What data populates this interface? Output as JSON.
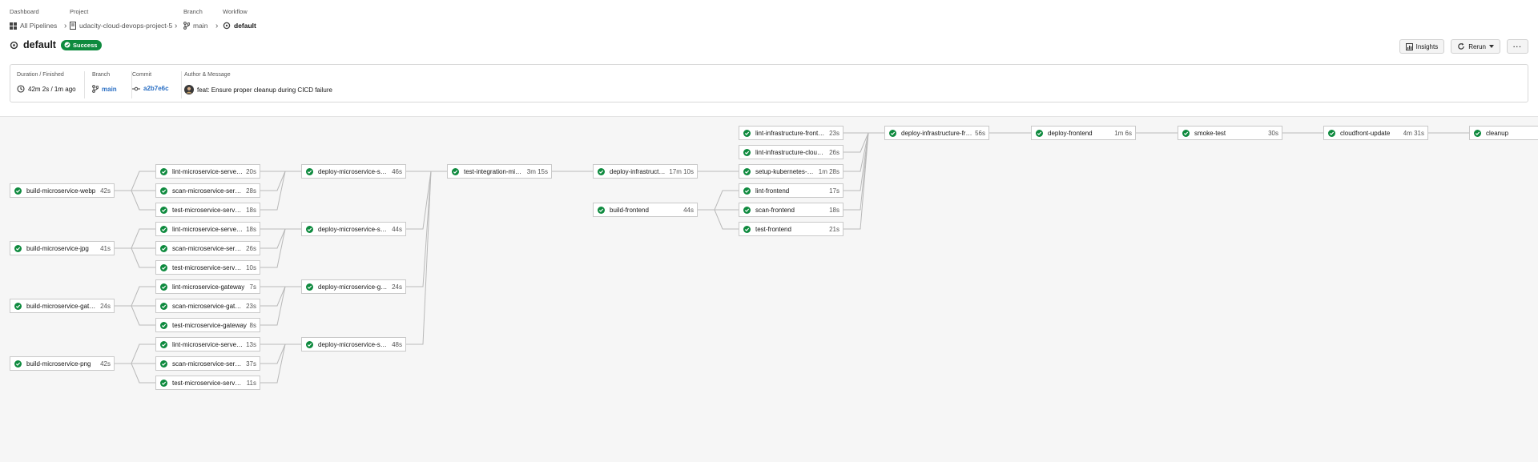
{
  "breadcrumbs": [
    {
      "caption": "Dashboard",
      "value": "All Pipelines",
      "icon": "pipelines-grid-icon"
    },
    {
      "caption": "Project",
      "value": "udacity-cloud-devops-project-5",
      "icon": "project-file-icon"
    },
    {
      "caption": "Branch",
      "value": "main",
      "icon": "branch-icon"
    },
    {
      "caption": "Workflow",
      "value": "default",
      "icon": "workflow-icon"
    }
  ],
  "workflow": {
    "title": "default",
    "status": "Success"
  },
  "actions": {
    "insights": "Insights",
    "rerun": "Rerun",
    "more": "···"
  },
  "info": {
    "duration_label": "Duration / Finished",
    "duration_value": "42m 2s / 1m ago",
    "branch_label": "Branch",
    "branch_value": "main",
    "commit_label": "Commit",
    "commit_value": "a2b7e6c",
    "author_label": "Author & Message",
    "message": "feat: Ensure proper cleanup during CICD failure"
  },
  "jobs": [
    {
      "id": "b_webp",
      "name": "build-microservice-webp",
      "duration": "42s",
      "needs": []
    },
    {
      "id": "b_jpg",
      "name": "build-microservice-jpg",
      "duration": "41s",
      "needs": []
    },
    {
      "id": "b_gw",
      "name": "build-microservice-gatew…",
      "duration": "24s",
      "needs": []
    },
    {
      "id": "b_png",
      "name": "build-microservice-png",
      "duration": "42s",
      "needs": []
    },
    {
      "id": "l_webp",
      "name": "lint-microservice-server-w…",
      "duration": "20s",
      "needs": [
        "b_webp"
      ]
    },
    {
      "id": "s_webp",
      "name": "scan-microservice-server-…",
      "duration": "28s",
      "needs": [
        "b_webp"
      ]
    },
    {
      "id": "t_webp",
      "name": "test-microservice-server-…",
      "duration": "18s",
      "needs": [
        "b_webp"
      ]
    },
    {
      "id": "l_jpg",
      "name": "lint-microservice-server-jpg",
      "duration": "18s",
      "needs": [
        "b_jpg"
      ]
    },
    {
      "id": "s_jpg",
      "name": "scan-microservice-server-…",
      "duration": "26s",
      "needs": [
        "b_jpg"
      ]
    },
    {
      "id": "t_jpg",
      "name": "test-microservice-server-j…",
      "duration": "10s",
      "needs": [
        "b_jpg"
      ]
    },
    {
      "id": "l_gw",
      "name": "lint-microservice-gateway",
      "duration": "7s",
      "needs": [
        "b_gw"
      ]
    },
    {
      "id": "s_gw",
      "name": "scan-microservice-gatew…",
      "duration": "23s",
      "needs": [
        "b_gw"
      ]
    },
    {
      "id": "t_gw",
      "name": "test-microservice-gateway",
      "duration": "8s",
      "needs": [
        "b_gw"
      ]
    },
    {
      "id": "l_png",
      "name": "lint-microservice-server-p…",
      "duration": "13s",
      "needs": [
        "b_png"
      ]
    },
    {
      "id": "s_png",
      "name": "scan-microservice-server-…",
      "duration": "37s",
      "needs": [
        "b_png"
      ]
    },
    {
      "id": "t_png",
      "name": "test-microservice-server-…",
      "duration": "11s",
      "needs": [
        "b_png"
      ]
    },
    {
      "id": "d_webp",
      "name": "deploy-microservice-serv…",
      "duration": "46s",
      "needs": [
        "l_webp",
        "s_webp",
        "t_webp"
      ]
    },
    {
      "id": "d_jpg",
      "name": "deploy-microservice-serv…",
      "duration": "44s",
      "needs": [
        "l_jpg",
        "s_jpg",
        "t_jpg"
      ]
    },
    {
      "id": "d_gw",
      "name": "deploy-microservice-gate…",
      "duration": "24s",
      "needs": [
        "l_gw",
        "s_gw",
        "t_gw"
      ]
    },
    {
      "id": "d_png",
      "name": "deploy-microservice-serv…",
      "duration": "48s",
      "needs": [
        "l_png",
        "s_png",
        "t_png"
      ]
    },
    {
      "id": "ti",
      "name": "test-integration-micro…",
      "duration": "3m 15s",
      "needs": [
        "d_webp",
        "d_jpg",
        "d_gw",
        "d_png"
      ]
    },
    {
      "id": "di",
      "name": "deploy-infrastructur…",
      "duration": "17m 10s",
      "needs": [
        "ti"
      ]
    },
    {
      "id": "bf",
      "name": "build-frontend",
      "duration": "44s",
      "needs": []
    },
    {
      "id": "lif",
      "name": "lint-infrastructure-frontend",
      "duration": "23s",
      "needs": []
    },
    {
      "id": "lic",
      "name": "lint-infrastructure-cloudfr…",
      "duration": "26s",
      "needs": []
    },
    {
      "id": "sk",
      "name": "setup-kubernetes-clu…",
      "duration": "1m 28s",
      "needs": [
        "di"
      ]
    },
    {
      "id": "lf",
      "name": "lint-frontend",
      "duration": "17s",
      "needs": [
        "bf"
      ]
    },
    {
      "id": "sf",
      "name": "scan-frontend",
      "duration": "18s",
      "needs": [
        "bf"
      ]
    },
    {
      "id": "tf",
      "name": "test-frontend",
      "duration": "21s",
      "needs": [
        "bf"
      ]
    },
    {
      "id": "dif",
      "name": "deploy-infrastructure-fron…",
      "duration": "56s",
      "needs": [
        "lif",
        "lic",
        "sk",
        "lf",
        "sf",
        "tf"
      ]
    },
    {
      "id": "df",
      "name": "deploy-frontend",
      "duration": "1m 6s",
      "needs": [
        "dif"
      ]
    },
    {
      "id": "st",
      "name": "smoke-test",
      "duration": "30s",
      "needs": [
        "df"
      ]
    },
    {
      "id": "cu",
      "name": "cloudfront-update",
      "duration": "4m 31s",
      "needs": [
        "st"
      ]
    },
    {
      "id": "cl",
      "name": "cleanup",
      "duration": "",
      "needs": [
        "cu"
      ]
    }
  ],
  "colors": {
    "success": "#0e8a3e",
    "link": "#2a6fc4",
    "edge": "#b9b9b9"
  }
}
